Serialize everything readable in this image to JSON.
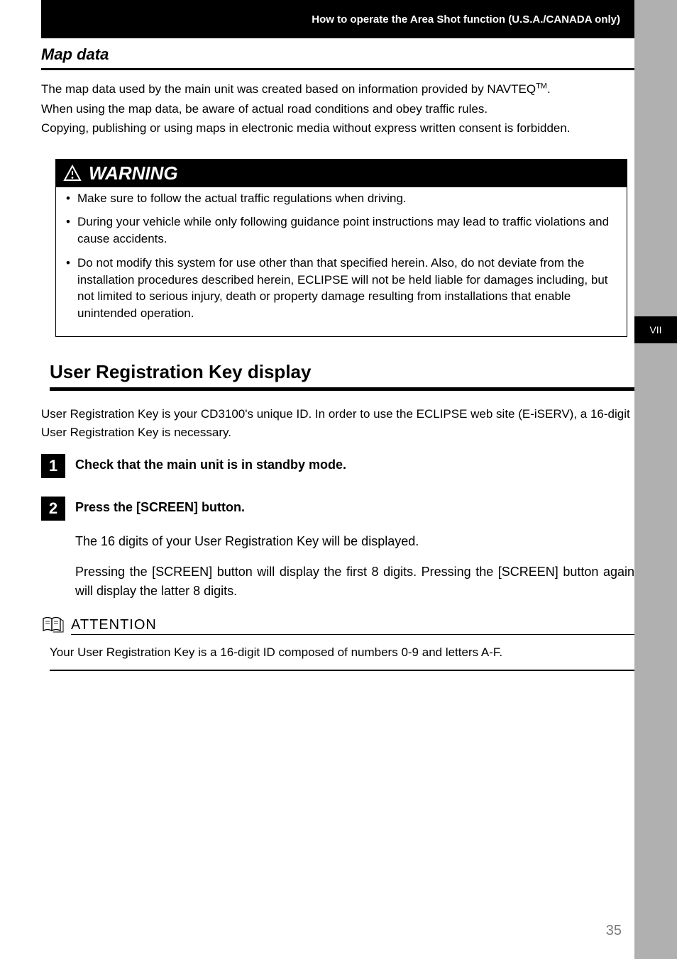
{
  "header": {
    "breadcrumb": "How to operate the Area Shot function (U.S.A./CANADA only)"
  },
  "side_tab": "VII",
  "map_data": {
    "title": "Map data",
    "p1_prefix": "The map data used by the main unit was created based on information provided by NAVTEQ",
    "p1_tm": "TM",
    "p1_suffix": ".",
    "p2": "When using the map data, be aware of actual road conditions and obey traffic rules.",
    "p3": "Copying, publishing or using maps in electronic media without express written consent is forbidden."
  },
  "warning": {
    "label": "WARNING",
    "items": [
      "Make sure to follow the actual traffic regulations when driving.",
      "During your vehicle while only following guidance point instructions may lead to traffic violations and cause accidents.",
      "Do not modify this system for use other than that specified herein. Also, do not deviate from the installation procedures described herein, ECLIPSE will not be held liable for damages including, but not limited to serious injury, death or property damage resulting from installations that enable unintended operation."
    ]
  },
  "user_reg": {
    "title": "User Registration Key display",
    "intro": "User Registration Key is your CD3100's unique ID. In order to use the ECLIPSE web site (E-iSERV), a 16-digit User Registration Key is necessary.",
    "steps": [
      {
        "num": "1",
        "title": "Check that the main unit is in standby mode."
      },
      {
        "num": "2",
        "title": "Press the [SCREEN] button.",
        "body1": "The 16 digits of your User Registration Key will be displayed.",
        "body2": "Pressing the [SCREEN] button will display the first 8 digits. Pressing the [SCREEN] button again will display the latter 8 digits."
      }
    ]
  },
  "attention": {
    "label": "ATTENTION",
    "body": "Your User Registration Key is a 16-digit ID composed of numbers 0-9 and letters A-F."
  },
  "page_number": "35"
}
